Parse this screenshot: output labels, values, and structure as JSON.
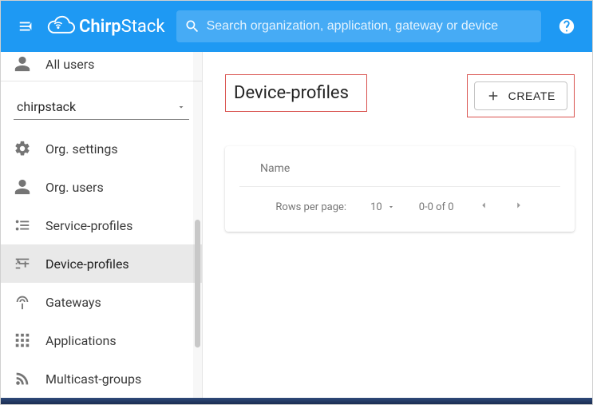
{
  "topbar": {
    "brand_bold": "Chirp",
    "brand_rest": "Stack",
    "search_placeholder": "Search organization, application, gateway or device"
  },
  "sidebar": {
    "top_cut_label": "All users",
    "org_selected": "chirpstack",
    "items": [
      {
        "label": "Org. settings"
      },
      {
        "label": "Org. users"
      },
      {
        "label": "Service-profiles"
      },
      {
        "label": "Device-profiles"
      },
      {
        "label": "Gateways"
      },
      {
        "label": "Applications"
      },
      {
        "label": "Multicast-groups"
      }
    ]
  },
  "main": {
    "title": "Device-profiles",
    "create_label": "Create",
    "table": {
      "columns": [
        "Name"
      ],
      "rows_per_page_label": "Rows per page:",
      "rows_per_page_value": "10",
      "range_text": "0-0 of 0"
    }
  }
}
